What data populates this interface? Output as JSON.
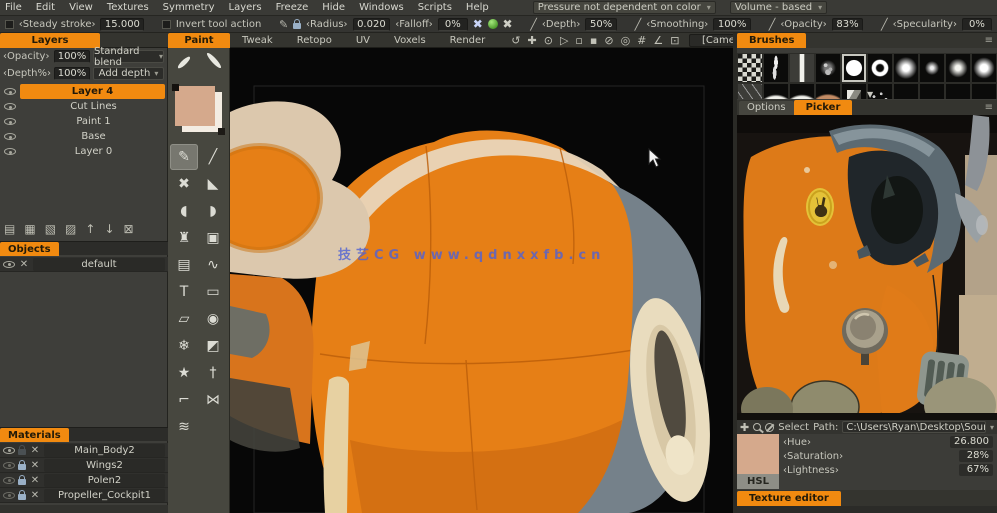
{
  "menu": {
    "items": [
      "File",
      "Edit",
      "View",
      "Textures",
      "Symmetry",
      "Layers",
      "Freeze",
      "Hide",
      "Windows",
      "Scripts",
      "Help"
    ],
    "pressure_mode": "Pressure not dependent on color",
    "volume_mode": "Volume - based"
  },
  "toolbar": {
    "steady_stroke_label": "‹Steady stroke›",
    "steady_stroke_value": "15.000",
    "invert_label": "Invert tool action",
    "radius_label": "‹Radius›",
    "radius_value": "0.020",
    "falloff_label": "‹Falloff›",
    "falloff_value": "0%",
    "depth_label": "‹Depth›",
    "depth_value": "50%",
    "smoothing_label": "‹Smoothing›",
    "smoothing_value": "100%",
    "opacity_label": "‹Opacity›",
    "opacity_value": "83%",
    "specularity_label": "‹Specularity›",
    "specularity_value": "0%"
  },
  "tabs": {
    "paint": "Paint",
    "others": [
      "Tweak",
      "Retopo",
      "UV",
      "Voxels",
      "Render"
    ],
    "camera": "[Camera]"
  },
  "nav_icons": [
    {
      "name": "rotate-view-icon",
      "g": "↺"
    },
    {
      "name": "pan-view-icon",
      "g": "✚"
    },
    {
      "name": "zoom-view-icon",
      "g": "⊙"
    },
    {
      "name": "play-icon",
      "g": "▷"
    },
    {
      "name": "snap-a-icon",
      "g": "▫"
    },
    {
      "name": "snap-b-icon",
      "g": "▪"
    },
    {
      "name": "disable-icon",
      "g": "⊘"
    },
    {
      "name": "globe-icon",
      "g": "◎"
    },
    {
      "name": "grid-icon",
      "g": "#"
    },
    {
      "name": "protractor-icon",
      "g": "∠"
    },
    {
      "name": "frame-icon",
      "g": "⊡"
    }
  ],
  "layers_panel": {
    "tab": "Layers",
    "opacity_label": "‹Opacity›",
    "opacity_value": "100%",
    "blend_mode": "Standard blend",
    "depth_label": "‹Depth%›",
    "depth_value": "100%",
    "depth_mode": "Add depth",
    "layers": [
      {
        "name": "Layer 4"
      },
      {
        "name": "Cut Lines"
      },
      {
        "name": "Paint 1"
      },
      {
        "name": "Base"
      },
      {
        "name": "Layer 0"
      }
    ],
    "tools": [
      {
        "name": "add-layer-icon",
        "g": "▤"
      },
      {
        "name": "delete-layer-icon",
        "g": "▦"
      },
      {
        "name": "copy-layer-icon",
        "g": "▧"
      },
      {
        "name": "duplicate-layer-icon",
        "g": "▨"
      },
      {
        "name": "move-layer-up-icon",
        "g": "↑"
      },
      {
        "name": "move-layer-down-icon",
        "g": "↓"
      },
      {
        "name": "clear-layer-icon",
        "g": "⊠"
      }
    ]
  },
  "objects_panel": {
    "tab": "Objects",
    "items": [
      {
        "name": "default"
      }
    ]
  },
  "materials_panel": {
    "tab": "Materials",
    "items": [
      {
        "name": "Main_Body2"
      },
      {
        "name": "Wings2"
      },
      {
        "name": "Polen2"
      },
      {
        "name": "Propeller_Cockpit1"
      }
    ]
  },
  "tools_column": [
    {
      "name": "brush-tool",
      "g": "✎"
    },
    {
      "name": "pencil-tool",
      "g": "╱"
    },
    {
      "name": "erase-brush-tool",
      "g": "✖"
    },
    {
      "name": "flat-brush-tool",
      "g": "◣"
    },
    {
      "name": "smudge-tool",
      "g": "◖"
    },
    {
      "name": "blob-tool",
      "g": "◗"
    },
    {
      "name": "stamp-tool",
      "g": "♜"
    },
    {
      "name": "transform-image-tool",
      "g": "▣"
    },
    {
      "name": "copy-tool",
      "g": "▤"
    },
    {
      "name": "spline-tool",
      "g": "∿"
    },
    {
      "name": "text-tool",
      "g": "T"
    },
    {
      "name": "crop-tool",
      "g": "▭"
    },
    {
      "name": "eraser-tool",
      "g": "▱"
    },
    {
      "name": "dodge-tool",
      "g": "◉"
    },
    {
      "name": "freeze-tool",
      "g": "❄"
    },
    {
      "name": "fill-tool",
      "g": "◩"
    },
    {
      "name": "wand-tool",
      "g": "★"
    },
    {
      "name": "knife-tool",
      "g": "†"
    },
    {
      "name": "bend-tool",
      "g": "⌐"
    },
    {
      "name": "symmetry-tool",
      "g": "⋈"
    },
    {
      "name": "spring-tool",
      "g": "≋"
    }
  ],
  "viewport": {
    "watermark": "技艺CG www.qdnxxfb.cn"
  },
  "brushes_panel": {
    "tab": "Brushes"
  },
  "picker_panel": {
    "options_tab": "Options",
    "picker_tab": "Picker",
    "select_label": "Select",
    "path_label": "Path:",
    "path_value": "C:\\Users\\Ryan\\Desktop\\Sour",
    "hsl_label": "HSL",
    "hue_label": "‹Hue›",
    "hue_value": "26.800",
    "saturation_label": "‹Saturation›",
    "saturation_value": "28%",
    "lightness_label": "‹Lightness›",
    "lightness_value": "67%"
  },
  "texture_editor_tab": "Texture editor",
  "glyphs": {
    "caret": "▾",
    "burger": "≡",
    "x": "✕",
    "xb": "✖",
    "pen": "╱",
    "brush": "✎",
    "tri": "▼"
  },
  "colors": {
    "accent": "#f18a10",
    "swatch": "#d5a98c",
    "watermark": "#4f62d4"
  }
}
